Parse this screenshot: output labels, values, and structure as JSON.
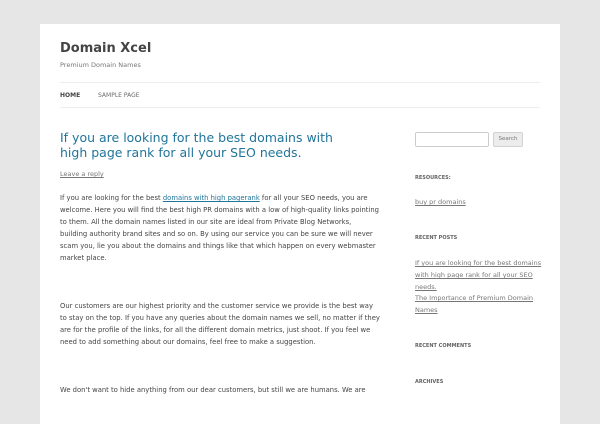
{
  "site": {
    "title": "Domain Xcel",
    "tagline": "Premium Domain Names"
  },
  "nav": [
    {
      "label": "Home"
    },
    {
      "label": "Sample Page"
    }
  ],
  "post": {
    "title": "If you are looking for the best domains with high page rank for all your SEO needs.",
    "leave_reply": "Leave a reply",
    "p1_before": "If you are looking for the best ",
    "p1_link": "domains with high pagerank",
    "p1_after": " for all your SEO needs, you are welcome. Here you will find the best high PR domains with a low of high-quality links pointing to them. All the domain names listed in our site are ideal from Private Blog Networks, building authority brand sites and so on. By using our service you can be sure we will never scam you, lie you about the domains and things like that which happen on every webmaster market place.",
    "p2": "Our customers are our highest priority and the customer service we provide is the best way to stay on the top. If you have any queries about the domain names we sell, no matter if they are for the profile of the links, for all the different domain metrics, just shoot. If you feel we need to add something about our domains, feel free to make a suggestion.",
    "p3": "We don't want to hide anything from our dear customers, but still we are humans. We are"
  },
  "sidebar": {
    "search_button": "Search",
    "resources_title": "Resources:",
    "resources_link": "buy pr domains",
    "recent_posts_title": "Recent Posts",
    "recent_posts": [
      "If you are looking for the best domains with high page rank for all your SEO needs.",
      "The Importance of Premium Domain Names"
    ],
    "recent_comments_title": "Recent Comments",
    "archives_title": "Archives"
  }
}
